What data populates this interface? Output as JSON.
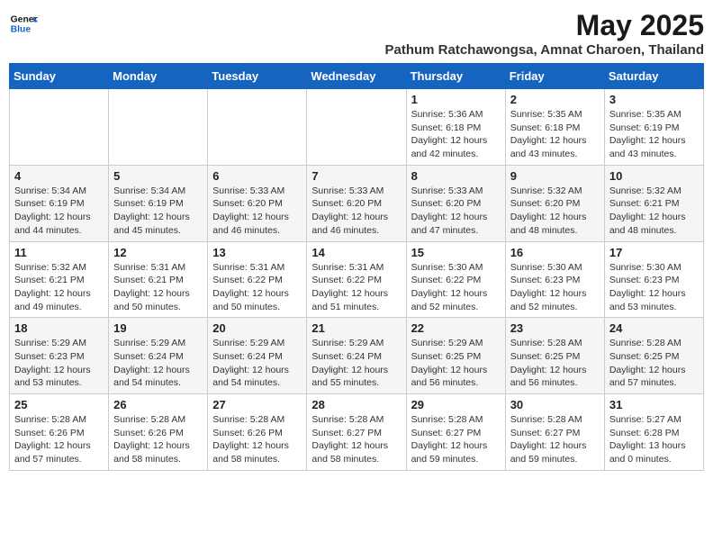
{
  "header": {
    "logo_line1": "General",
    "logo_line2": "Blue",
    "title": "May 2025",
    "subtitle": "Pathum Ratchawongsa, Amnat Charoen, Thailand"
  },
  "weekdays": [
    "Sunday",
    "Monday",
    "Tuesday",
    "Wednesday",
    "Thursday",
    "Friday",
    "Saturday"
  ],
  "weeks": [
    [
      {
        "day": "",
        "info": ""
      },
      {
        "day": "",
        "info": ""
      },
      {
        "day": "",
        "info": ""
      },
      {
        "day": "",
        "info": ""
      },
      {
        "day": "1",
        "info": "Sunrise: 5:36 AM\nSunset: 6:18 PM\nDaylight: 12 hours\nand 42 minutes."
      },
      {
        "day": "2",
        "info": "Sunrise: 5:35 AM\nSunset: 6:18 PM\nDaylight: 12 hours\nand 43 minutes."
      },
      {
        "day": "3",
        "info": "Sunrise: 5:35 AM\nSunset: 6:19 PM\nDaylight: 12 hours\nand 43 minutes."
      }
    ],
    [
      {
        "day": "4",
        "info": "Sunrise: 5:34 AM\nSunset: 6:19 PM\nDaylight: 12 hours\nand 44 minutes."
      },
      {
        "day": "5",
        "info": "Sunrise: 5:34 AM\nSunset: 6:19 PM\nDaylight: 12 hours\nand 45 minutes."
      },
      {
        "day": "6",
        "info": "Sunrise: 5:33 AM\nSunset: 6:20 PM\nDaylight: 12 hours\nand 46 minutes."
      },
      {
        "day": "7",
        "info": "Sunrise: 5:33 AM\nSunset: 6:20 PM\nDaylight: 12 hours\nand 46 minutes."
      },
      {
        "day": "8",
        "info": "Sunrise: 5:33 AM\nSunset: 6:20 PM\nDaylight: 12 hours\nand 47 minutes."
      },
      {
        "day": "9",
        "info": "Sunrise: 5:32 AM\nSunset: 6:20 PM\nDaylight: 12 hours\nand 48 minutes."
      },
      {
        "day": "10",
        "info": "Sunrise: 5:32 AM\nSunset: 6:21 PM\nDaylight: 12 hours\nand 48 minutes."
      }
    ],
    [
      {
        "day": "11",
        "info": "Sunrise: 5:32 AM\nSunset: 6:21 PM\nDaylight: 12 hours\nand 49 minutes."
      },
      {
        "day": "12",
        "info": "Sunrise: 5:31 AM\nSunset: 6:21 PM\nDaylight: 12 hours\nand 50 minutes."
      },
      {
        "day": "13",
        "info": "Sunrise: 5:31 AM\nSunset: 6:22 PM\nDaylight: 12 hours\nand 50 minutes."
      },
      {
        "day": "14",
        "info": "Sunrise: 5:31 AM\nSunset: 6:22 PM\nDaylight: 12 hours\nand 51 minutes."
      },
      {
        "day": "15",
        "info": "Sunrise: 5:30 AM\nSunset: 6:22 PM\nDaylight: 12 hours\nand 52 minutes."
      },
      {
        "day": "16",
        "info": "Sunrise: 5:30 AM\nSunset: 6:23 PM\nDaylight: 12 hours\nand 52 minutes."
      },
      {
        "day": "17",
        "info": "Sunrise: 5:30 AM\nSunset: 6:23 PM\nDaylight: 12 hours\nand 53 minutes."
      }
    ],
    [
      {
        "day": "18",
        "info": "Sunrise: 5:29 AM\nSunset: 6:23 PM\nDaylight: 12 hours\nand 53 minutes."
      },
      {
        "day": "19",
        "info": "Sunrise: 5:29 AM\nSunset: 6:24 PM\nDaylight: 12 hours\nand 54 minutes."
      },
      {
        "day": "20",
        "info": "Sunrise: 5:29 AM\nSunset: 6:24 PM\nDaylight: 12 hours\nand 54 minutes."
      },
      {
        "day": "21",
        "info": "Sunrise: 5:29 AM\nSunset: 6:24 PM\nDaylight: 12 hours\nand 55 minutes."
      },
      {
        "day": "22",
        "info": "Sunrise: 5:29 AM\nSunset: 6:25 PM\nDaylight: 12 hours\nand 56 minutes."
      },
      {
        "day": "23",
        "info": "Sunrise: 5:28 AM\nSunset: 6:25 PM\nDaylight: 12 hours\nand 56 minutes."
      },
      {
        "day": "24",
        "info": "Sunrise: 5:28 AM\nSunset: 6:25 PM\nDaylight: 12 hours\nand 57 minutes."
      }
    ],
    [
      {
        "day": "25",
        "info": "Sunrise: 5:28 AM\nSunset: 6:26 PM\nDaylight: 12 hours\nand 57 minutes."
      },
      {
        "day": "26",
        "info": "Sunrise: 5:28 AM\nSunset: 6:26 PM\nDaylight: 12 hours\nand 58 minutes."
      },
      {
        "day": "27",
        "info": "Sunrise: 5:28 AM\nSunset: 6:26 PM\nDaylight: 12 hours\nand 58 minutes."
      },
      {
        "day": "28",
        "info": "Sunrise: 5:28 AM\nSunset: 6:27 PM\nDaylight: 12 hours\nand 58 minutes."
      },
      {
        "day": "29",
        "info": "Sunrise: 5:28 AM\nSunset: 6:27 PM\nDaylight: 12 hours\nand 59 minutes."
      },
      {
        "day": "30",
        "info": "Sunrise: 5:28 AM\nSunset: 6:27 PM\nDaylight: 12 hours\nand 59 minutes."
      },
      {
        "day": "31",
        "info": "Sunrise: 5:27 AM\nSunset: 6:28 PM\nDaylight: 13 hours\nand 0 minutes."
      }
    ]
  ]
}
